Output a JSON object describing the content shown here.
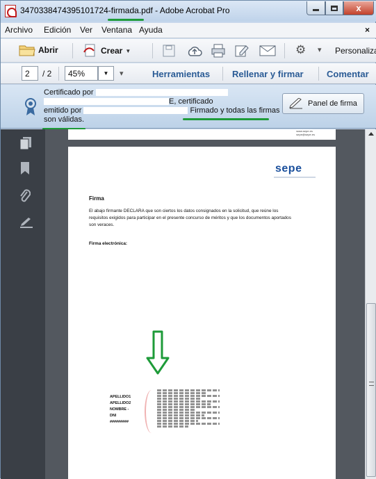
{
  "window": {
    "title": "3470338474395101724-firmada.pdf - Adobe Acrobat Pro",
    "close_glyph": "x"
  },
  "menu": {
    "items": [
      "Archivo",
      "Edición",
      "Ver",
      "Ventana",
      "Ayuda"
    ],
    "close_glyph": "×"
  },
  "toolbar": {
    "open_label": "Abrir",
    "create_label": "Crear",
    "customize_label": "Personalizar"
  },
  "nav": {
    "current_page": "2",
    "total_pages": "/ 2",
    "zoom": "45%",
    "tools_label": "Herramientas",
    "fill_sign_label": "Rellenar y firmar",
    "comment_label": "Comentar"
  },
  "signature_banner": {
    "line1_prefix": "Certificado por",
    "line2_suffix": "E, certificado",
    "line3_prefix": "emitido por",
    "line3_status": "Firmado y todas las firmas",
    "line4_status": "son válidas.",
    "panel_button_label": "Panel de firma"
  },
  "document": {
    "page1_footer_lines": [
      "www.sepe.es",
      "sepe@sepe.es"
    ],
    "logo_text": "sepe",
    "heading": "Firma",
    "paragraph": "El abajo firmante DECLARA que son ciertos los datos consignados en la solicitud, que reúne los requisitos exigidos para participar en el presente concurso de méritos y que los documentos aportados son veraces.",
    "efirma_label": "Firma electrónica:",
    "signer_fields": [
      "APELLIDO1",
      "APELLIDO2",
      "NOMBRE -",
      "DNI",
      "#########"
    ]
  },
  "colors": {
    "link_blue": "#2a5b95",
    "annotation_green": "#1e9b39",
    "doc_background": "#53585f"
  },
  "icons": [
    "folder-icon",
    "create-icon",
    "save-icon",
    "upload-icon",
    "print-icon",
    "edit-icon",
    "email-icon",
    "gear-icon",
    "ribbon-icon",
    "pen-icon",
    "pages-icon",
    "bookmark-icon",
    "paperclip-icon",
    "signature-icon"
  ]
}
